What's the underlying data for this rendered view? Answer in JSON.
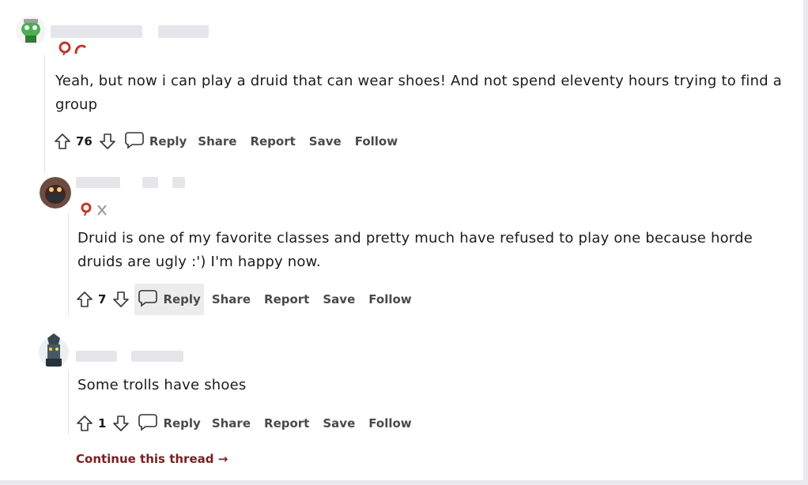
{
  "comments": [
    {
      "text_line1": "Yeah, but now i can play a druid that can wear shoes! And not spend eleventy hours trying to find a",
      "text_line2": "group",
      "votes": "76",
      "actions": {
        "reply": "Reply",
        "share": "Share",
        "report": "Report",
        "save": "Save",
        "follow": "Follow"
      }
    },
    {
      "text_line1": "Druid is one of my favorite classes and pretty much have refused to play one because horde",
      "text_line2": "druids are ugly :') I'm happy now.",
      "votes": "7",
      "actions": {
        "reply": "Reply",
        "share": "Share",
        "report": "Report",
        "save": "Save",
        "follow": "Follow"
      }
    },
    {
      "text_line1": "Some trolls have shoes",
      "votes": "1",
      "actions": {
        "reply": "Reply",
        "share": "Share",
        "report": "Report",
        "save": "Save",
        "follow": "Follow"
      }
    }
  ],
  "continue_thread": "Continue this thread",
  "continue_arrow": "→",
  "colors": {
    "flair_red": "#c0392b",
    "link": "#7a1f1f",
    "text": "#1c1c1c"
  }
}
